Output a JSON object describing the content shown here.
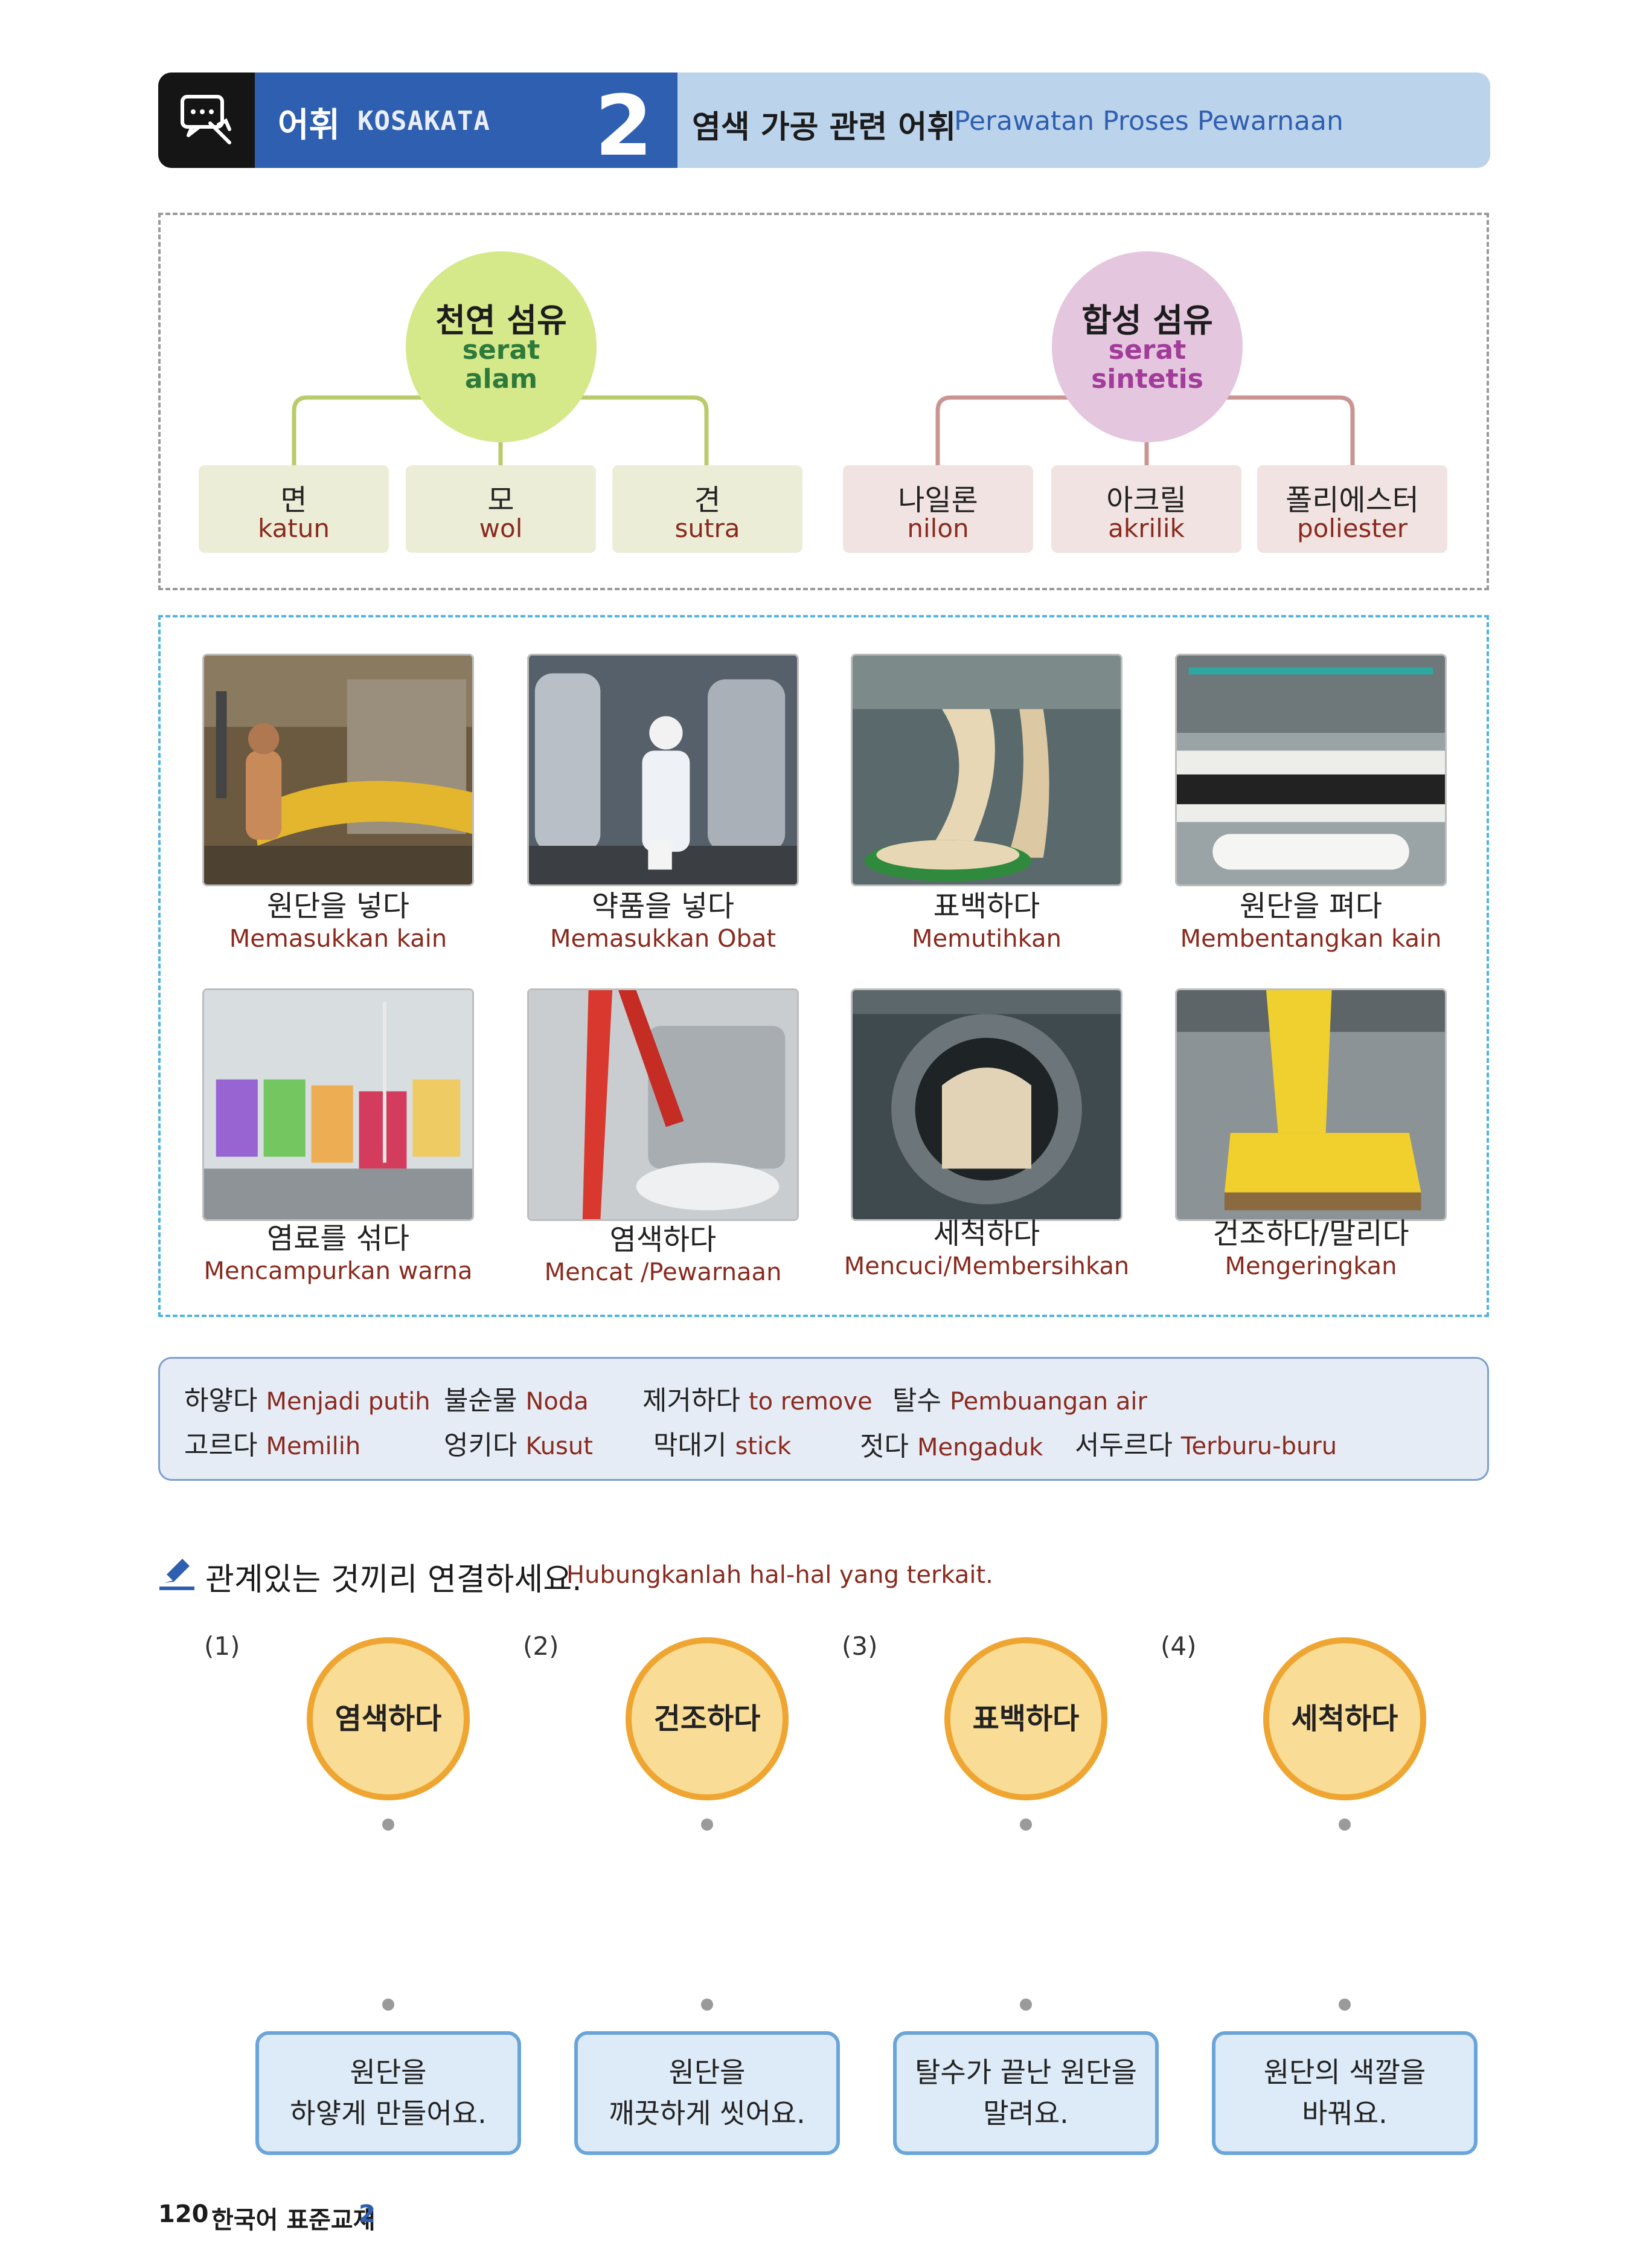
{
  "header": {
    "section_ko": "어휘",
    "section_id": "KOSAKATA",
    "number": "2",
    "title_ko": "염색 가공 관련 어휘",
    "title_id": "Perawatan Proses Pewarnaan",
    "icon": "vocabulary-icon"
  },
  "fibers": {
    "natural": {
      "ko": "천연 섬유",
      "id_line1": "serat",
      "id_line2": "alam",
      "color": "#d5e88a"
    },
    "synthetic": {
      "ko": "합성 섬유",
      "id_line1": "serat",
      "id_line2": "sintetis",
      "color": "#e4c6de"
    },
    "items": [
      {
        "ko": "면",
        "id": "katun"
      },
      {
        "ko": "모",
        "id": "wol"
      },
      {
        "ko": "견",
        "id": "sutra"
      },
      {
        "ko": "나일론",
        "id": "nilon"
      },
      {
        "ko": "아크릴",
        "id": "akrilik"
      },
      {
        "ko": "폴리에스터",
        "id": "poliester"
      }
    ]
  },
  "photos": [
    {
      "ko": "원단을 넣다",
      "id": "Memasukkan kain"
    },
    {
      "ko": "약품을 넣다",
      "id": "Memasukkan Obat"
    },
    {
      "ko": "표백하다",
      "id": "Memutihkan"
    },
    {
      "ko": "원단을 펴다",
      "id": "Membentangkan kain"
    },
    {
      "ko": "염료를 섞다",
      "id": "Mencampurkan warna"
    },
    {
      "ko": "염색하다",
      "id": "Mencat /Pewarnaan"
    },
    {
      "ko": "세척하다",
      "id": "Mencuci/Membersihkan"
    },
    {
      "ko": "건조하다/말리다",
      "id": "Mengeringkan"
    }
  ],
  "words": [
    {
      "ko": "하얗다",
      "id": "Menjadi putih"
    },
    {
      "ko": "불순물",
      "id": "Noda"
    },
    {
      "ko": "제거하다",
      "id": "to remove"
    },
    {
      "ko": "탈수",
      "id": "Pembuangan air"
    },
    {
      "ko": "고르다",
      "id": "Memilih"
    },
    {
      "ko": "엉키다",
      "id": "Kusut"
    },
    {
      "ko": "막대기",
      "id": "stick"
    },
    {
      "ko": "젓다",
      "id": "Mengaduk"
    },
    {
      "ko": "서두르다",
      "id": "Terburu-buru"
    }
  ],
  "exercise": {
    "instruction_ko": "관계있는 것끼리 연결하세요.",
    "instruction_id": "Hubungkanlah hal-hal yang terkait.",
    "icon": "pencil-icon",
    "items": [
      {
        "num": "(1)",
        "word": "염색하다"
      },
      {
        "num": "(2)",
        "word": "건조하다"
      },
      {
        "num": "(3)",
        "word": "표백하다"
      },
      {
        "num": "(4)",
        "word": "세척하다"
      }
    ],
    "answers": [
      {
        "line1": "원단을",
        "line2": "하얗게 만들어요."
      },
      {
        "line1": "원단을",
        "line2": "깨끗하게 씻어요."
      },
      {
        "line1": "탈수가 끝난 원단을",
        "line2": "말려요."
      },
      {
        "line1": "원단의 색깔을",
        "line2": "바꿔요."
      }
    ]
  },
  "footer": {
    "page": "120",
    "book": "한국어 표준교재",
    "volume": "2"
  }
}
